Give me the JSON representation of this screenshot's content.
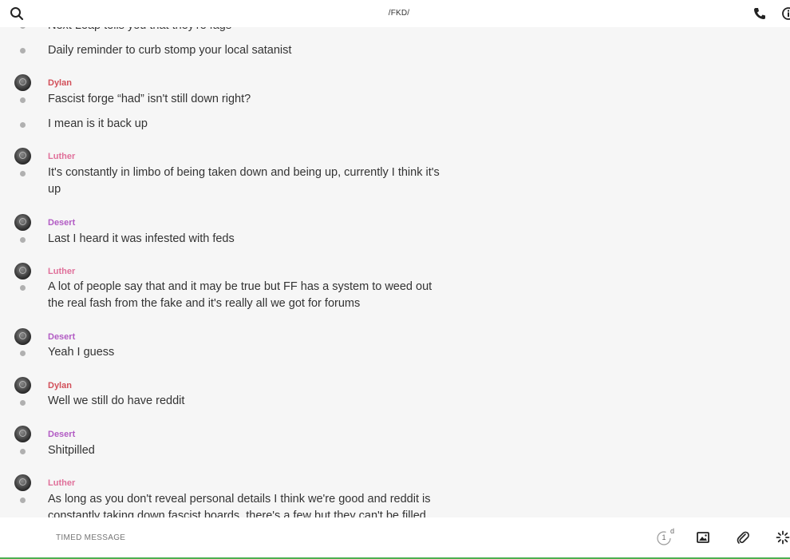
{
  "header": {
    "title": "/FKD/",
    "icons": {
      "search": "search-icon",
      "call": "phone-icon",
      "info": "info-icon"
    }
  },
  "colors": {
    "Dylan": "#d2505a",
    "Luther": "#e0709a",
    "Desert": "#b25cc4",
    "dot": "#b0b0b0",
    "accent_bar": "#4caf50"
  },
  "messages": [
    {
      "lines": [
        "Next Leap tells you that they're fags"
      ]
    },
    {
      "lines": [
        "Daily reminder to curb stomp your local satanist"
      ]
    },
    {
      "author": "Dylan",
      "lines": [
        "Fascist forge “had” isn't still down right?",
        "I mean is it back up"
      ]
    },
    {
      "author": "Luther",
      "lines": [
        "It's constantly in limbo of being taken down and being up, currently I think it's up"
      ]
    },
    {
      "author": "Desert",
      "lines": [
        "Last I heard it was infested with feds"
      ]
    },
    {
      "author": "Luther",
      "lines": [
        "A lot of people say that and it may be true but FF has a system to weed out the real fash from the fake and it's really all we got for forums"
      ]
    },
    {
      "author": "Desert",
      "lines": [
        "Yeah I guess"
      ]
    },
    {
      "author": "Dylan",
      "lines": [
        "Well we still do have reddit"
      ]
    },
    {
      "author": "Desert",
      "lines": [
        "Shitpilled"
      ]
    },
    {
      "author": "Luther",
      "lines": [
        "As long as you don't reveal personal details I think we're good and reddit is constantly taking down fascist boards, there's a few but they can't be filled"
      ]
    }
  ],
  "composer": {
    "placeholder": "TIMED MESSAGE",
    "timer_count": "1",
    "timer_unit": "d",
    "icons": {
      "timer": "timer-icon",
      "image": "image-icon",
      "attach": "paperclip-icon",
      "more": "sparkle-icon"
    }
  }
}
